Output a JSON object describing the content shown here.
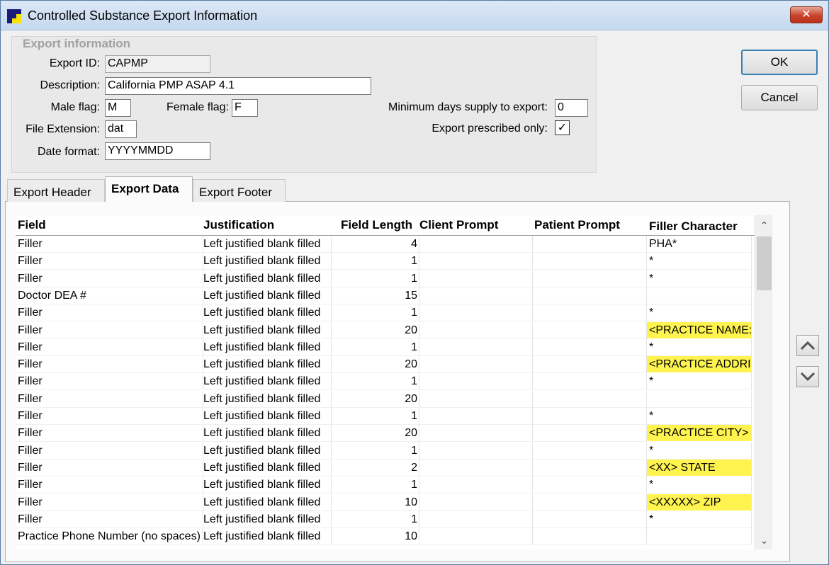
{
  "window": {
    "title": "Controlled Substance Export Information",
    "close_label": "✕"
  },
  "export_info": {
    "group_label": "Export information",
    "export_id_label": "Export ID:",
    "export_id": "CAPMP",
    "description_label": "Description:",
    "description": "California PMP ASAP 4.1",
    "male_flag_label": "Male flag:",
    "male_flag": "M",
    "female_flag_label": "Female flag:",
    "female_flag": "F",
    "file_ext_label": "File Extension:",
    "file_ext": "dat",
    "date_format_label": "Date format:",
    "date_format": "YYYYMMDD",
    "min_days_label": "Minimum days supply to export:",
    "min_days": "0",
    "prescribed_only_label": "Export prescribed only:",
    "prescribed_only_checked": true,
    "check_mark": "✓"
  },
  "buttons": {
    "ok": "OK",
    "cancel": "Cancel"
  },
  "tabs": [
    "Export Header",
    "Export Data",
    "Export Footer"
  ],
  "active_tab": "Export Data",
  "grid": {
    "columns": [
      "Field",
      "Justification",
      "Field Length",
      "Client Prompt",
      "Patient Prompt",
      "Filler Character"
    ],
    "rows": [
      {
        "field": "Filler",
        "justification": "Left justified blank filled",
        "length": "4",
        "client": "",
        "patient": "",
        "filler": "PHA*",
        "highlight": false
      },
      {
        "field": "Filler",
        "justification": "Left justified blank filled",
        "length": "1",
        "client": "",
        "patient": "",
        "filler": "*",
        "highlight": false
      },
      {
        "field": "Filler",
        "justification": "Left justified blank filled",
        "length": "1",
        "client": "",
        "patient": "",
        "filler": "*",
        "highlight": false
      },
      {
        "field": "Doctor DEA #",
        "justification": "Left justified blank filled",
        "length": "15",
        "client": "",
        "patient": "",
        "filler": "",
        "highlight": false
      },
      {
        "field": "Filler",
        "justification": "Left justified blank filled",
        "length": "1",
        "client": "",
        "patient": "",
        "filler": "*",
        "highlight": false
      },
      {
        "field": "Filler",
        "justification": "Left justified blank filled",
        "length": "20",
        "client": "",
        "patient": "",
        "filler": "<PRACTICE NAME:",
        "highlight": true
      },
      {
        "field": "Filler",
        "justification": "Left justified blank filled",
        "length": "1",
        "client": "",
        "patient": "",
        "filler": "*",
        "highlight": false
      },
      {
        "field": "Filler",
        "justification": "Left justified blank filled",
        "length": "20",
        "client": "",
        "patient": "",
        "filler": "<PRACTICE ADDRI",
        "highlight": true
      },
      {
        "field": "Filler",
        "justification": "Left justified blank filled",
        "length": "1",
        "client": "",
        "patient": "",
        "filler": "*",
        "highlight": false
      },
      {
        "field": "Filler",
        "justification": "Left justified blank filled",
        "length": "20",
        "client": "",
        "patient": "",
        "filler": "",
        "highlight": false
      },
      {
        "field": "Filler",
        "justification": "Left justified blank filled",
        "length": "1",
        "client": "",
        "patient": "",
        "filler": "*",
        "highlight": false
      },
      {
        "field": "Filler",
        "justification": "Left justified blank filled",
        "length": "20",
        "client": "",
        "patient": "",
        "filler": "<PRACTICE CITY>",
        "highlight": true
      },
      {
        "field": "Filler",
        "justification": "Left justified blank filled",
        "length": "1",
        "client": "",
        "patient": "",
        "filler": "*",
        "highlight": false
      },
      {
        "field": "Filler",
        "justification": "Left justified blank filled",
        "length": "2",
        "client": "",
        "patient": "",
        "filler": "<XX> STATE",
        "highlight": true
      },
      {
        "field": "Filler",
        "justification": "Left justified blank filled",
        "length": "1",
        "client": "",
        "patient": "",
        "filler": "*",
        "highlight": false
      },
      {
        "field": "Filler",
        "justification": "Left justified blank filled",
        "length": "10",
        "client": "",
        "patient": "",
        "filler": "<XXXXX> ZIP",
        "highlight": true
      },
      {
        "field": "Filler",
        "justification": "Left justified blank filled",
        "length": "1",
        "client": "",
        "patient": "",
        "filler": "*",
        "highlight": false
      },
      {
        "field": "Practice Phone Number (no spaces)",
        "justification": "Left justified blank filled",
        "length": "10",
        "client": "",
        "patient": "",
        "filler": "",
        "highlight": false
      }
    ]
  },
  "scrollbar": {
    "up_arrow": "⌃",
    "down_arrow": "⌄"
  },
  "move_buttons": {
    "up_icon": "move-up-icon",
    "down_icon": "move-down-icon"
  },
  "colors": {
    "highlight": "#fff44f",
    "titlebar": "#c5d8ef",
    "default_button_border": "#3c7fb1"
  }
}
